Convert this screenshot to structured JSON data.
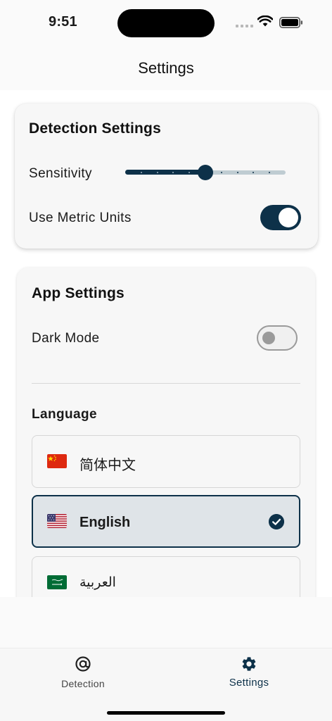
{
  "status_bar": {
    "time": "9:51"
  },
  "header": {
    "title": "Settings"
  },
  "detection_card": {
    "title": "Detection Settings",
    "sensitivity_label": "Sensitivity",
    "sensitivity_value": 0.5,
    "slider_divisions": 10,
    "metric_label": "Use Metric Units",
    "metric_enabled": true
  },
  "app_card": {
    "title": "App Settings",
    "dark_mode_label": "Dark Mode",
    "dark_mode_enabled": false,
    "language_heading": "Language",
    "languages": [
      {
        "name": "简体中文",
        "flag": "china-flag-icon",
        "selected": false
      },
      {
        "name": "English",
        "flag": "usa-flag-icon",
        "selected": true
      },
      {
        "name": "العربية",
        "flag": "saudi-arabia-flag-icon",
        "selected": false
      }
    ]
  },
  "bottom_nav": {
    "items": [
      {
        "label": "Detection",
        "icon": "at-target-icon",
        "active": false
      },
      {
        "label": "Settings",
        "icon": "gear-icon",
        "active": true
      }
    ]
  },
  "colors": {
    "accent": "#0d3149",
    "track_inactive": "#bfccd2",
    "card_background": "#f7f7f7",
    "selected_background": "#dfe4e8"
  }
}
